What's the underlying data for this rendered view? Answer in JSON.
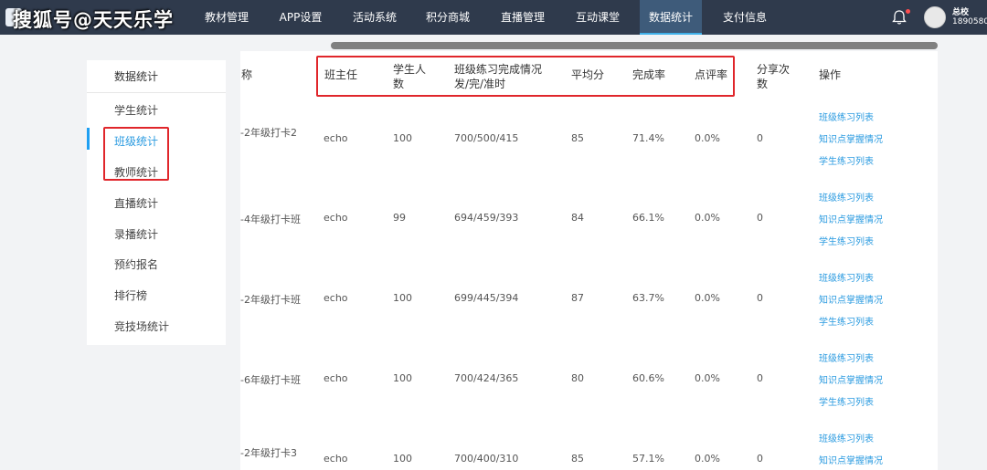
{
  "watermark": "搜狐号@天天乐学",
  "nav": {
    "items": [
      "教材管理",
      "APP设置",
      "活动系统",
      "积分商城",
      "直播管理",
      "互动课堂",
      "数据统计",
      "支付信息"
    ],
    "active": "数据统计"
  },
  "user": {
    "name": "总校",
    "phone": "1890580"
  },
  "sidebar": {
    "header": "数据统计",
    "items": [
      "学生统计",
      "班级统计",
      "教师统计",
      "直播统计",
      "录播统计",
      "预约报名",
      "排行榜",
      "竞技场统计"
    ],
    "active": "班级统计"
  },
  "table": {
    "headers": {
      "name": "称",
      "teacher": "班主任",
      "students_l1": "学生人",
      "students_l2": "数",
      "practice_l1": "班级练习完成情况",
      "practice_l2": "发/完/准时",
      "avg": "平均分",
      "completion": "完成率",
      "review": "点评率",
      "share_l1": "分享次",
      "share_l2": "数",
      "ops": "操作"
    },
    "rows": [
      {
        "name": "-2年级打卡2",
        "teacher": "echo",
        "students": "100",
        "practice": "700/500/415",
        "avg": "85",
        "completion": "71.4%",
        "review": "0.0%",
        "share": "0"
      },
      {
        "name": "-4年级打卡班",
        "teacher": "echo",
        "students": "99",
        "practice": "694/459/393",
        "avg": "84",
        "completion": "66.1%",
        "review": "0.0%",
        "share": "0"
      },
      {
        "name": "-2年级打卡班",
        "teacher": "echo",
        "students": "100",
        "practice": "699/445/394",
        "avg": "87",
        "completion": "63.7%",
        "review": "0.0%",
        "share": "0"
      },
      {
        "name": "-6年级打卡班",
        "teacher": "echo",
        "students": "100",
        "practice": "700/424/365",
        "avg": "80",
        "completion": "60.6%",
        "review": "0.0%",
        "share": "0"
      },
      {
        "name": "-2年级打卡3",
        "teacher": "echo",
        "students": "100",
        "practice": "700/400/310",
        "avg": "85",
        "completion": "57.1%",
        "review": "0.0%",
        "share": "0"
      }
    ],
    "ops": [
      "班级练习列表",
      "知识点掌握情况",
      "学生练习列表"
    ]
  },
  "colors": {
    "nav_bg": "#2f3a4c",
    "accent": "#2b9be0",
    "highlight": "#e0262b"
  }
}
